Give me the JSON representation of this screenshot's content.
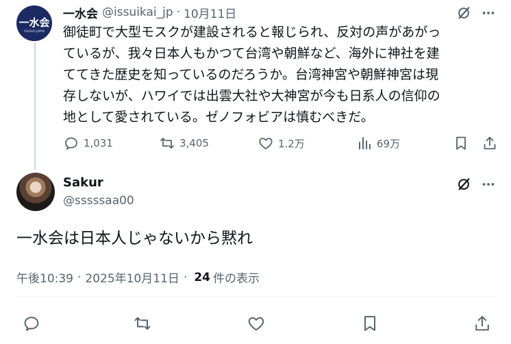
{
  "parent_tweet": {
    "avatar": {
      "logo_text": "一水会",
      "logo_subtext": "ISSUIKAI JAPAN"
    },
    "author_name": "一水会",
    "author_handle": "@issuikai_jp",
    "separator": "·",
    "date": "10月11日",
    "body_lines": [
      "御徒町で大型モスクが建設されると報じられ、反対の声があがっ",
      "ているが、我々日本人もかつて台湾や朝鮮など、海外に神社を建",
      "ててきた歴史を知っているのだろうか。台湾神宮や朝鮮神宮は現",
      "存しないが、ハワイでは出雲大社や大神宮が今も日系人の信仰の",
      "地として愛されている。ゼノフォビアは慎むべきだ。"
    ],
    "metrics": {
      "replies": "1,031",
      "reposts": "3,405",
      "likes": "1.2万",
      "views": "69万"
    }
  },
  "reply_tweet": {
    "author_name": "Sakur",
    "author_handle": "@sssssaa00",
    "body": "一水会は日本人じゃないから黙れ",
    "time": "午後10:39",
    "separator": "·",
    "date": "2025年10月11日",
    "views_count": "24",
    "views_label": "件の表示"
  },
  "icons": {
    "grok": "grok-icon",
    "more": "more-icon",
    "reply": "reply-icon",
    "repost": "repost-icon",
    "like": "like-icon",
    "views": "views-icon",
    "bookmark": "bookmark-icon",
    "share": "share-icon"
  },
  "colors": {
    "text_primary": "#0f1419",
    "text_secondary": "#536471",
    "logo_bg": "#1b2a63",
    "divider": "#eff3f4",
    "thread_line": "#cfd9de"
  }
}
